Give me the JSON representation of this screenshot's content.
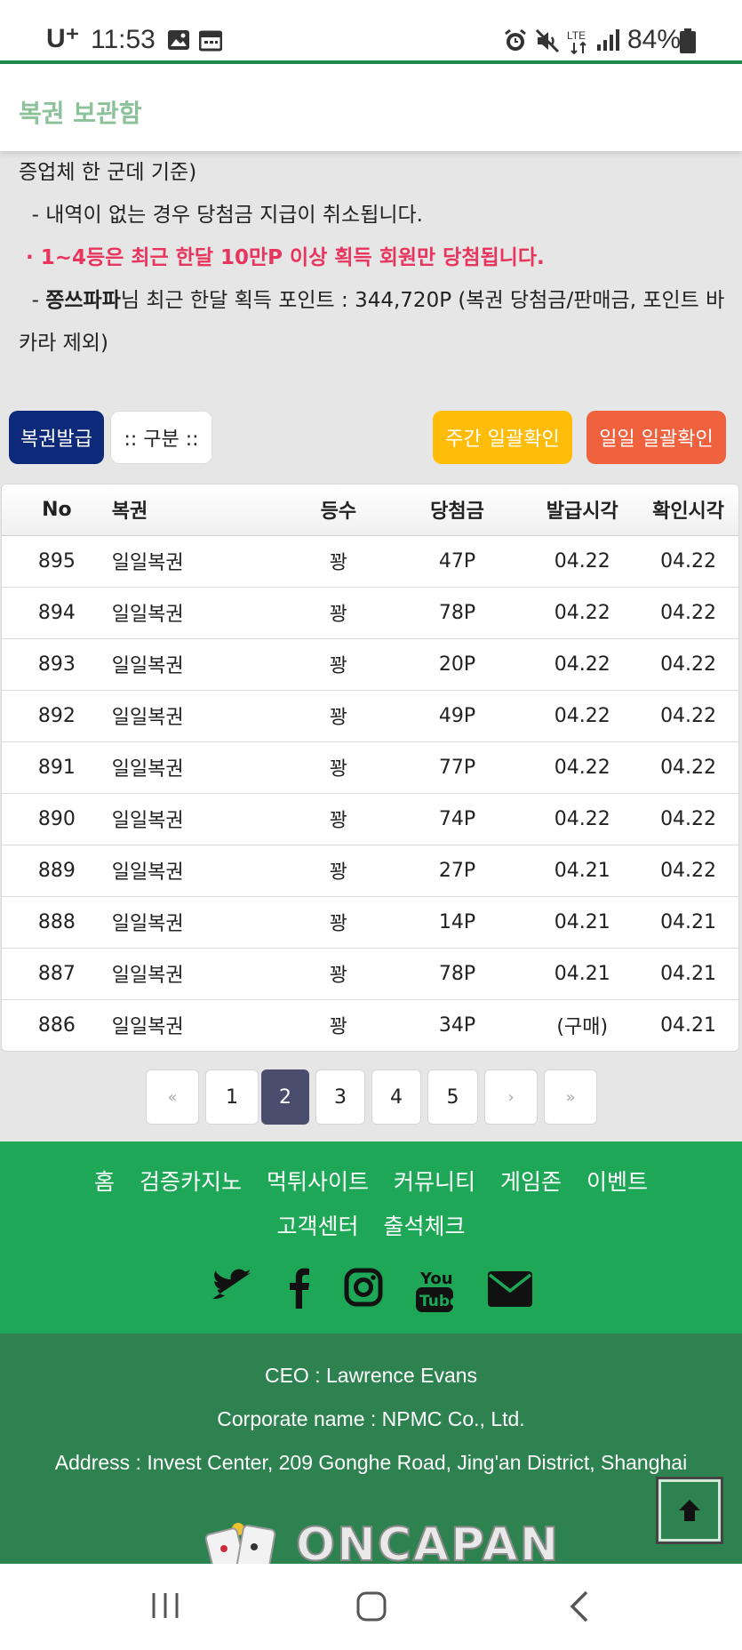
{
  "status_bar": {
    "carrier": "U⁺",
    "time": "11:53",
    "battery": "84%"
  },
  "header": {
    "title": "복권 보관함"
  },
  "notice": {
    "line1": "증업체 한 군데 기준)",
    "line2": "  - 내역이 없는 경우 당첨금 지급이 취소됩니다.",
    "line3": " · 1~4등은 최근 한달 10만P 이상 획득 회원만 당첨됩니다.",
    "line4_prefix": "  - ",
    "line4_user": "쫑쓰파파",
    "line4_rest": "님 최근 한달 획득 포인트 : 344,720P (복권 당첨금/판매금, 포인트 바",
    "line5": "카라 제외)"
  },
  "buttons": {
    "issue": "복권발급",
    "category": ":: 구분 ::",
    "weekly": "주간 일괄확인",
    "daily": "일일 일괄확인"
  },
  "table": {
    "headers": {
      "no": "No",
      "name": "복권",
      "rank": "등수",
      "prize": "당첨금",
      "issued": "발급시각",
      "checked": "확인시각"
    },
    "rows": [
      {
        "no": "895",
        "name": "일일복권",
        "rank": "꽝",
        "prize": "47P",
        "issued": "04.22",
        "checked": "04.22"
      },
      {
        "no": "894",
        "name": "일일복권",
        "rank": "꽝",
        "prize": "78P",
        "issued": "04.22",
        "checked": "04.22"
      },
      {
        "no": "893",
        "name": "일일복권",
        "rank": "꽝",
        "prize": "20P",
        "issued": "04.22",
        "checked": "04.22"
      },
      {
        "no": "892",
        "name": "일일복권",
        "rank": "꽝",
        "prize": "49P",
        "issued": "04.22",
        "checked": "04.22"
      },
      {
        "no": "891",
        "name": "일일복권",
        "rank": "꽝",
        "prize": "77P",
        "issued": "04.22",
        "checked": "04.22"
      },
      {
        "no": "890",
        "name": "일일복권",
        "rank": "꽝",
        "prize": "74P",
        "issued": "04.22",
        "checked": "04.22"
      },
      {
        "no": "889",
        "name": "일일복권",
        "rank": "꽝",
        "prize": "27P",
        "issued": "04.21",
        "checked": "04.22"
      },
      {
        "no": "888",
        "name": "일일복권",
        "rank": "꽝",
        "prize": "14P",
        "issued": "04.21",
        "checked": "04.21"
      },
      {
        "no": "887",
        "name": "일일복권",
        "rank": "꽝",
        "prize": "78P",
        "issued": "04.21",
        "checked": "04.21"
      },
      {
        "no": "886",
        "name": "일일복권",
        "rank": "꽝",
        "prize": "34P",
        "issued": "(구매)",
        "checked": "04.21"
      }
    ]
  },
  "pagination": {
    "first": "«",
    "pages": [
      "1",
      "2",
      "3",
      "4",
      "5"
    ],
    "active_page": "2",
    "next": "›",
    "last": "»"
  },
  "footer_nav": {
    "row1": [
      "홈",
      "검증카지노",
      "먹튀사이트",
      "커뮤니티",
      "게임존",
      "이벤트"
    ],
    "row2": [
      "고객센터",
      "출석체크"
    ],
    "social_icons": [
      "twitter-icon",
      "facebook-icon",
      "instagram-icon",
      "youtube-icon",
      "mail-icon"
    ]
  },
  "footer_info": {
    "ceo": "CEO : Lawrence Evans",
    "corporate": "Corporate name : NPMC Co., Ltd.",
    "address": "Address : Invest Center, 209 Gonghe Road, Jing'an District, Shanghai",
    "logo": "ONCAPAN"
  },
  "colors": {
    "status_line": "#1f8a4c",
    "header_title": "#8cc29a",
    "issue_button": "#0d2a7a",
    "weekly_button": "#ffbd0a",
    "daily_button": "#f0613d",
    "notice_red": "#e8355e",
    "footer_nav_bg": "#1ea757",
    "footer_info_bg": "#2e8250",
    "active_page": "#4a4d6e"
  }
}
